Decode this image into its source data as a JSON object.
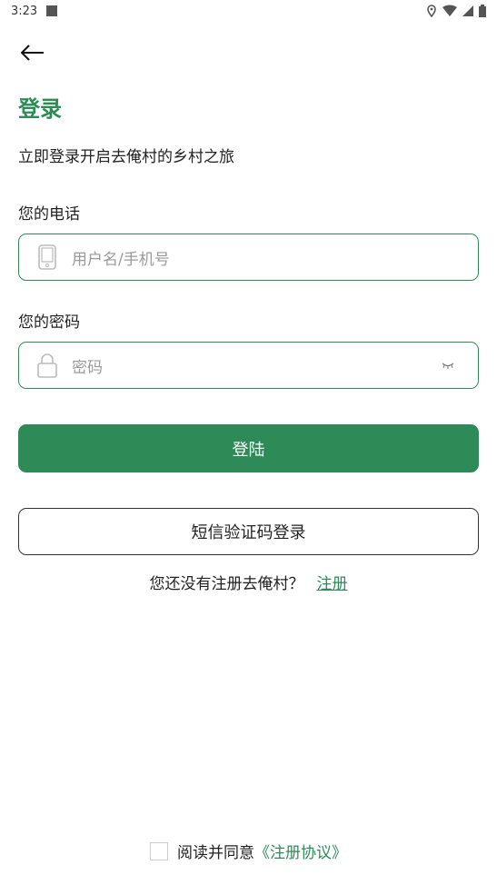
{
  "status": {
    "time": "3:23"
  },
  "page": {
    "title": "登录",
    "subtitle": "立即登录开启去俺村的乡村之旅"
  },
  "phone": {
    "label": "您的电话",
    "placeholder": "用户名/手机号"
  },
  "password": {
    "label": "您的密码",
    "placeholder": "密码"
  },
  "buttons": {
    "login": "登陆",
    "sms_login": "短信验证码登录"
  },
  "register": {
    "prompt": "您还没有注册去俺村？",
    "link": "注册"
  },
  "agreement": {
    "text": "阅读并同意",
    "link": "《注册协议》"
  },
  "colors": {
    "accent": "#2e8b57"
  }
}
